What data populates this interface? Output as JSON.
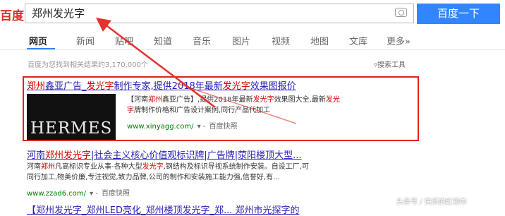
{
  "header": {
    "logo": "百度",
    "search_value": "郑州发光字",
    "search_button": "百度一下"
  },
  "tabs": [
    "网页",
    "新闻",
    "贴吧",
    "知道",
    "音乐",
    "图片",
    "视频",
    "地图",
    "文库",
    "更多»"
  ],
  "results_count": "百度为您找到相关结果约3,170,000个",
  "tools_label": "搜索工具",
  "results": [
    {
      "title_parts": [
        "郑州",
        "鑫亚广告_",
        "发光字",
        "制作专家,提供2018年最新",
        "发光字",
        "效果图报价"
      ],
      "desc_line1_parts": [
        "【河南",
        "郑州",
        "鑫亚广告】,提供2018年最新",
        "发光字",
        "效果图大全,最新",
        "发光"
      ],
      "desc_line2_parts": [
        "字",
        "牌制作价格和广告设计案例,同行产品代加工"
      ],
      "url": "www.xinyagg.com/",
      "snapshot": "百度快照",
      "thumb_text": "HERMES"
    },
    {
      "title_parts": [
        "河南",
        "郑州",
        "发光字",
        "|社会主义核心价值观标识牌|广告牌|荥阳楼顶大型..."
      ],
      "desc_line1_parts": [
        "河南",
        "郑州",
        "凡高标识专业从事-各种大型",
        "发光字",
        ",钢结构及标识导视系统制作安装。自设工厂,可"
      ],
      "desc_line2": "同行加工,物美价廉,专注视觉,致力品牌,公司的制作和安装施工能力强,信誉好,有...",
      "url": "www.zzad6.com/",
      "snapshot": "百度快照"
    }
  ],
  "partial_title": "【郑州发光字_郑州LED亮化_郑州楼顶发光字_郑...  郑州市光探字的",
  "watermark": "头条号 / 快乐的红领巾",
  "colors": {
    "accent": "#3385ff",
    "link": "#2a22b8",
    "highlight": "#cc0000",
    "box": "#d9261c",
    "url": "#008000"
  }
}
